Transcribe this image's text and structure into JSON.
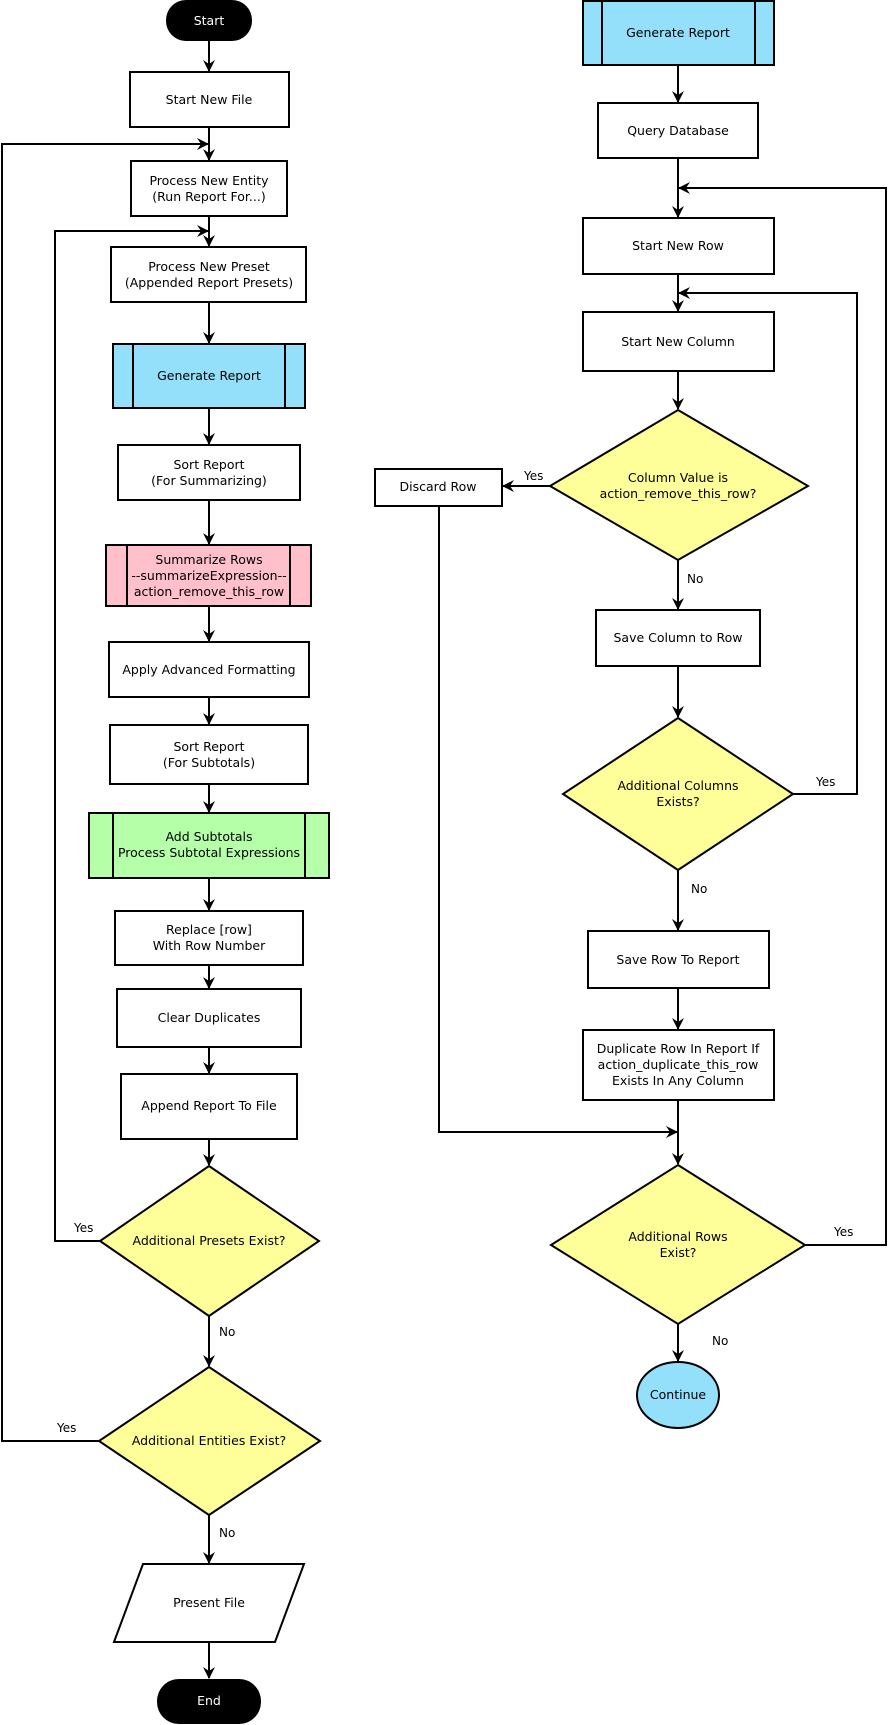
{
  "colors": {
    "process": "#ffffff",
    "subroutine_blue": "#94dff9",
    "subroutine_pink": "#ffc0cb",
    "subroutine_green": "#b4ffa8",
    "decision": "#ffff99",
    "terminal": "#000000",
    "connector": "#94dff9"
  },
  "left_flow": {
    "start": "Start",
    "start_new_file": "Start New File",
    "process_new_entity": [
      "Process New Entity",
      "(Run Report For...)"
    ],
    "process_new_preset": [
      "Process New Preset",
      "(Appended Report Presets)"
    ],
    "generate_report": "Generate Report",
    "sort_report_summarizing": [
      "Sort Report",
      "(For Summarizing)"
    ],
    "summarize_rows": [
      "Summarize Rows",
      "--summarizeExpression--",
      "action_remove_this_row"
    ],
    "apply_advanced_formatting": "Apply Advanced Formatting",
    "sort_report_subtotals": [
      "Sort Report",
      "(For Subtotals)"
    ],
    "add_subtotals": [
      "Add Subtotals",
      "Process Subtotal Expressions"
    ],
    "replace_row": [
      "Replace [row]",
      "With Row Number"
    ],
    "clear_duplicates": "Clear Duplicates",
    "append_report": "Append Report To File",
    "presets_decision": "Additional Presets Exist?",
    "entities_decision": "Additional Entities Exist?",
    "present_file": "Present File",
    "end": "End",
    "labels": {
      "presets_yes": "Yes",
      "presets_no": "No",
      "entities_yes": "Yes",
      "entities_no": "No"
    }
  },
  "right_flow": {
    "generate_report": "Generate Report",
    "query_database": "Query Database",
    "start_new_row": "Start New Row",
    "start_new_column": "Start New Column",
    "column_value_decision": [
      "Column Value is",
      "action_remove_this_row?"
    ],
    "discard_row": "Discard Row",
    "save_column": "Save Column to Row",
    "columns_decision": [
      "Additional Columns",
      "Exists?"
    ],
    "save_row": "Save Row To Report",
    "duplicate_row": [
      "Duplicate Row In Report If",
      "action_duplicate_this_row",
      "Exists In Any Column"
    ],
    "rows_decision": [
      "Additional Rows",
      "Exist?"
    ],
    "continue": "Continue",
    "labels": {
      "column_value_yes": "Yes",
      "column_value_no": "No",
      "columns_yes": "Yes",
      "columns_no": "No",
      "rows_yes": "Yes",
      "rows_no": "No"
    }
  }
}
